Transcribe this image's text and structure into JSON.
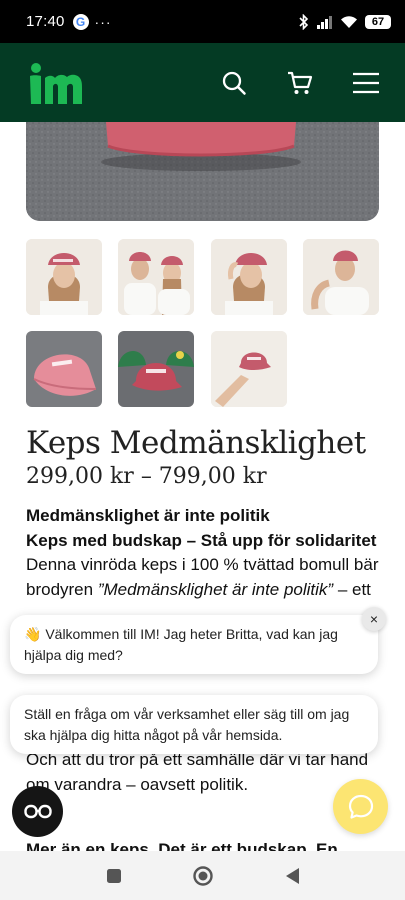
{
  "status": {
    "time": "17:40",
    "google_letter": "G",
    "more_dots": "···",
    "battery": "67",
    "icons": [
      "google-icon",
      "bluetooth-icon",
      "signal-icon",
      "wifi-icon",
      "battery-icon"
    ]
  },
  "header": {
    "logo_text": "im",
    "brand_color": "#043b24",
    "logo_color": "#1db954",
    "icons": [
      "search-icon",
      "cart-icon",
      "menu-icon"
    ]
  },
  "product": {
    "title": "Keps Medmänsklighet",
    "price": "299,00 kr – 799,00 kr",
    "thumbnails": [
      "woman-cap-1",
      "couple-caps",
      "woman-cap-2",
      "man-cap",
      "pink-cap",
      "three-caps",
      "hand-cap"
    ],
    "description": {
      "heading1": "Medmänsklighet är inte politik",
      "heading2": "Keps med budskap – Stå upp för solidaritet",
      "p1_start": "Denna vinröda keps i 100 % tvättad bomull bär brodyren ",
      "p1_quote": "”Medmänsklighet är inte politik”",
      "p1_end": " – ett",
      "p2": "Och att du tror på ett samhälle där vi tar hand om varandra – oavsett politik.",
      "p3": "Mer än en keps. Det är ett budskap. En"
    }
  },
  "chat": {
    "greeting": "👋 Välkommen till IM! Jag heter Britta, vad kan jag hjälpa dig med?",
    "prompt": "Ställ en fråga om vår verksamhet eller säg till om jag ska hjälpa dig hitta något på vår hemsida.",
    "close_label": "×",
    "button_color": "#fce572"
  },
  "navbar": {
    "icons": [
      "recents-icon",
      "home-icon",
      "back-icon"
    ]
  }
}
